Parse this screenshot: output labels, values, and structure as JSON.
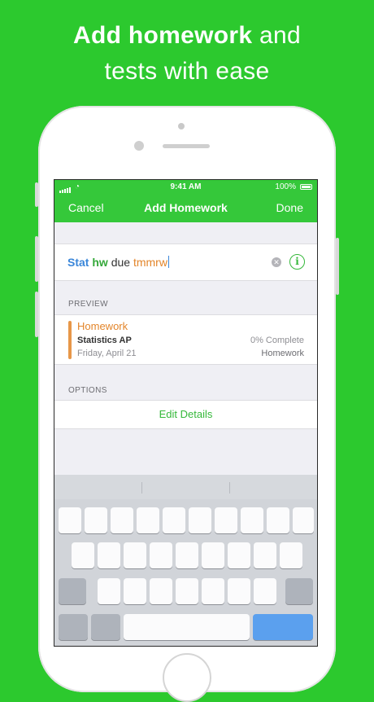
{
  "headline": {
    "bold": "Add homework",
    "light_first": "and",
    "light_second": "tests with ease"
  },
  "status_bar": {
    "time": "9:41 AM",
    "battery": "100%"
  },
  "nav": {
    "cancel": "Cancel",
    "title": "Add Homework",
    "done": "Done"
  },
  "input": {
    "course_token": "Stat",
    "type_token": "hw",
    "plain_token": "due",
    "date_token": "tmmrw"
  },
  "preview": {
    "header": "PREVIEW",
    "type": "Homework",
    "course": "Statistics AP",
    "date": "Friday, April 21",
    "complete": "0% Complete",
    "category": "Homework"
  },
  "options": {
    "header": "OPTIONS",
    "edit_details": "Edit Details"
  },
  "icons": {
    "clear": "clear-icon",
    "info": "info-icon",
    "signal": "signal-icon",
    "wifi": "wifi-icon",
    "battery": "battery-icon"
  },
  "colors": {
    "background": "#2cc92e",
    "nav": "#35c83a",
    "course_token": "#3a86d9",
    "type_token": "#35a83a",
    "date_token": "#e3852a",
    "accent": "#e79749"
  }
}
